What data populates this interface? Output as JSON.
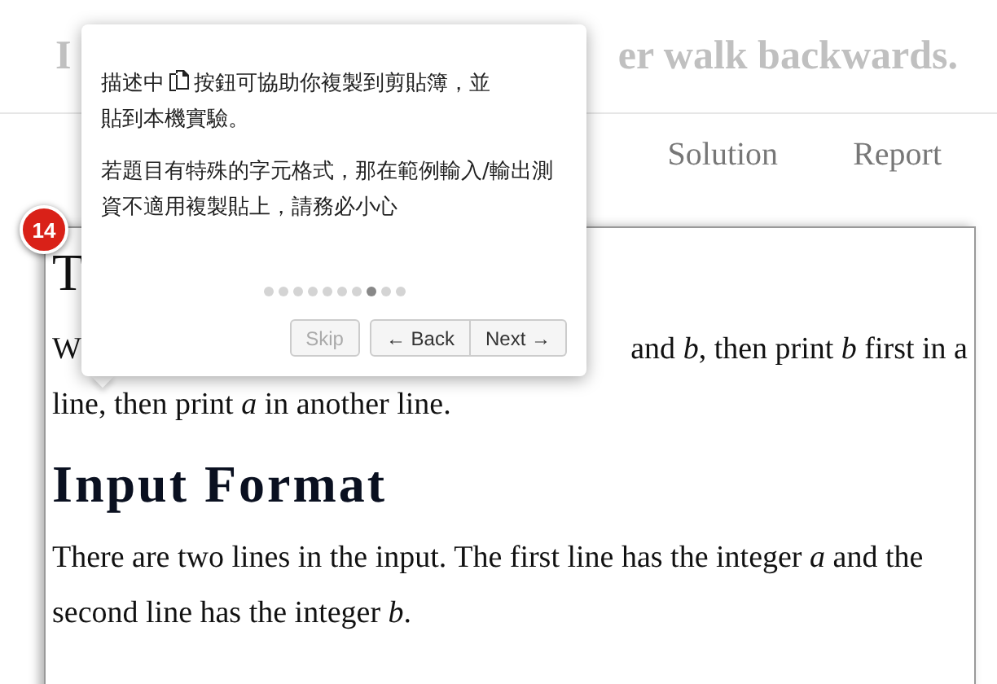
{
  "header": {
    "title_start": "I",
    "title_end": "er walk backwards."
  },
  "nav": {
    "items": [
      {
        "label": "Solution",
        "selected": false
      },
      {
        "label": "Report",
        "selected": false
      }
    ]
  },
  "problem": {
    "heading_visible": "T",
    "line1_start": "W",
    "line1_end": "and *b*, then print *b* first in a",
    "line_rest": "line, then print *a* in another line.",
    "input_heading": "Input Format",
    "input_text": "There are two lines in the input. The first line has the integer *a* and the second line has the integer *b*."
  },
  "tour": {
    "badge": "14",
    "text_before_icon": "描述中",
    "text_after_icon": "按鈕可協助你複製到剪貼簿，並",
    "text_line2": "貼到本機實驗。",
    "note": "若題目有特殊的字元格式，那在範例輸入/輸出測資不適用複製貼上，請務必小心",
    "steps": [
      {
        "selected": false
      },
      {
        "selected": false
      },
      {
        "selected": false
      },
      {
        "selected": false
      },
      {
        "selected": false
      },
      {
        "selected": false
      },
      {
        "selected": false
      },
      {
        "selected": true
      },
      {
        "selected": false
      },
      {
        "selected": false
      }
    ],
    "buttons": [
      {
        "label": "Skip",
        "disabled": true,
        "kind": "single"
      },
      {
        "label": "← Back",
        "disabled": false,
        "kind": "left"
      },
      {
        "label": "Next →",
        "disabled": false,
        "kind": "right"
      }
    ]
  }
}
